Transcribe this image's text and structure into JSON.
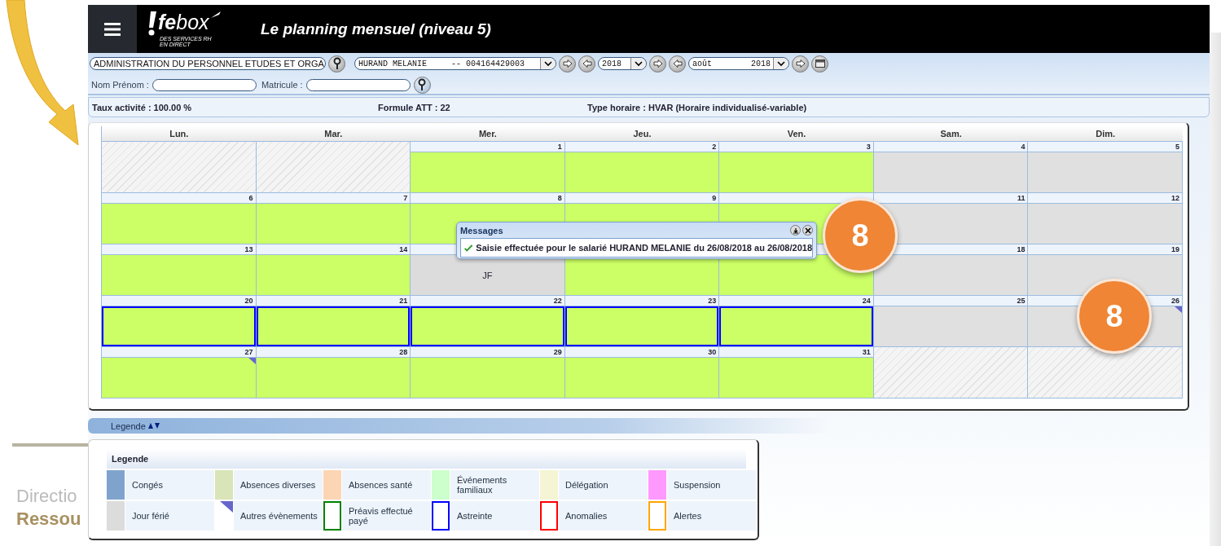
{
  "header": {
    "logo": "**fe**box",
    "tagline": [
      "DES SERVICES RH",
      "EN DIRECT"
    ],
    "title": "Le planning mensuel (niveau 5)"
  },
  "filters": {
    "department": "ADMINISTRATION DU PERSONNEL ETUDES ET ORGA",
    "employee": "HURAND MELANIE     -- 004164429003",
    "year": "2018",
    "month": "août        2018"
  },
  "search": [
    {
      "label": "Nom Prénom :"
    },
    {
      "label": "Matricule :"
    }
  ],
  "info": [
    "Taux activité : 100.00 %",
    "Formule ATT : 22",
    "Type horaire : HVAR (Horaire individualisé-variable)"
  ],
  "weekdays": [
    "Lun.",
    "Mar.",
    "Mer.",
    "Jeu.",
    "Ven.",
    "Sam.",
    "Dim."
  ],
  "weeks": [
    [
      {
        "kind": "empty",
        "on_call": false,
        "other_event": false
      },
      {
        "kind": "empty",
        "on_call": false,
        "other_event": false
      },
      {
        "day": "1",
        "kind": "work",
        "on_call": false,
        "other_event": false
      },
      {
        "day": "2",
        "kind": "work",
        "on_call": false,
        "other_event": false
      },
      {
        "day": "3",
        "kind": "work",
        "on_call": false,
        "other_event": false
      },
      {
        "day": "4",
        "kind": "rest",
        "on_call": false,
        "other_event": false
      },
      {
        "day": "5",
        "kind": "rest",
        "on_call": false,
        "other_event": false
      }
    ],
    [
      {
        "day": "6",
        "kind": "work",
        "on_call": false,
        "other_event": false
      },
      {
        "day": "7",
        "kind": "work",
        "on_call": false,
        "other_event": false
      },
      {
        "day": "8",
        "kind": "work",
        "on_call": false,
        "other_event": false
      },
      {
        "day": "9",
        "kind": "work",
        "on_call": false,
        "other_event": false
      },
      {
        "kind": "work",
        "on_call": false
      },
      {
        "day": "11",
        "kind": "rest",
        "on_call": false,
        "other_event": false
      },
      {
        "day": "12",
        "kind": "rest",
        "on_call": false,
        "other_event": false
      }
    ],
    [
      {
        "day": "13",
        "kind": "work",
        "on_call": false,
        "other_event": false
      },
      {
        "day": "14",
        "kind": "work",
        "on_call": false,
        "other_event": false
      },
      {
        "kind": "holiday",
        "label": "JF",
        "on_call": false,
        "other_event": false
      },
      {
        "kind": "work",
        "on_call": false,
        "other_event": false
      },
      {
        "kind": "work",
        "on_call": false
      },
      {
        "day": "18",
        "kind": "rest",
        "on_call": false,
        "other_event": false
      },
      {
        "day": "19",
        "kind": "rest",
        "on_call": false,
        "other_event": false
      }
    ],
    [
      {
        "day": "20",
        "kind": "work",
        "on_call": true,
        "other_event": false
      },
      {
        "day": "21",
        "kind": "work",
        "on_call": true,
        "other_event": false
      },
      {
        "day": "22",
        "kind": "work",
        "on_call": true,
        "other_event": false
      },
      {
        "day": "23",
        "kind": "work",
        "on_call": true,
        "other_event": false
      },
      {
        "day": "24",
        "kind": "work",
        "on_call": true,
        "other_event": false
      },
      {
        "day": "25",
        "kind": "rest",
        "on_call": false,
        "other_event": false
      },
      {
        "day": "26",
        "kind": "rest",
        "on_call": false,
        "other_event": true
      }
    ],
    [
      {
        "day": "27",
        "kind": "work",
        "on_call": false,
        "other_event": true
      },
      {
        "day": "28",
        "kind": "work",
        "on_call": false,
        "other_event": false
      },
      {
        "day": "29",
        "kind": "work",
        "on_call": false,
        "other_event": false
      },
      {
        "day": "30",
        "kind": "work",
        "on_call": false,
        "other_event": false
      },
      {
        "day": "31",
        "kind": "work",
        "on_call": false,
        "other_event": false
      },
      {
        "kind": "empty",
        "on_call": false,
        "other_event": false
      },
      {
        "kind": "empty",
        "on_call": false,
        "other_event": false
      }
    ]
  ],
  "message": {
    "title": "Messages",
    "text": "Saisie effectuée pour le salarié HURAND MELANIE du 26/08/2018 au 26/08/2018"
  },
  "badges": [
    "8",
    "8"
  ],
  "legend_bar": "Legende",
  "legend": {
    "title": "Legende",
    "items": [
      {
        "label": "Congés",
        "kind": "fill",
        "color": "#7fa3cc"
      },
      {
        "label": "Absences diverses",
        "kind": "fill",
        "color": "#d9e4b8"
      },
      {
        "label": "Absences santé",
        "kind": "fill",
        "color": "#fcd5b5"
      },
      {
        "label": "Événements familiaux",
        "kind": "fill",
        "color": "#ccffcc"
      },
      {
        "label": "Délégation",
        "kind": "fill",
        "color": "#f5f5d5"
      },
      {
        "label": "Suspension",
        "kind": "fill",
        "color": "#ff99ff"
      },
      {
        "label": "Jour férié",
        "kind": "fill",
        "color": "#dcdcdc"
      },
      {
        "label": "Autres évènements",
        "kind": "corner",
        "color": "#6666cc"
      },
      {
        "label": "Préavis effectué payé",
        "kind": "outline",
        "color": "#008000"
      },
      {
        "label": "Astreinte",
        "kind": "outline",
        "color": "#0000ff"
      },
      {
        "label": "Anomalies",
        "kind": "outline",
        "color": "#ff0000"
      },
      {
        "label": "Alertes",
        "kind": "outline",
        "color": "#ffa500"
      }
    ]
  },
  "background_text": [
    "Directio",
    "Ressou"
  ]
}
